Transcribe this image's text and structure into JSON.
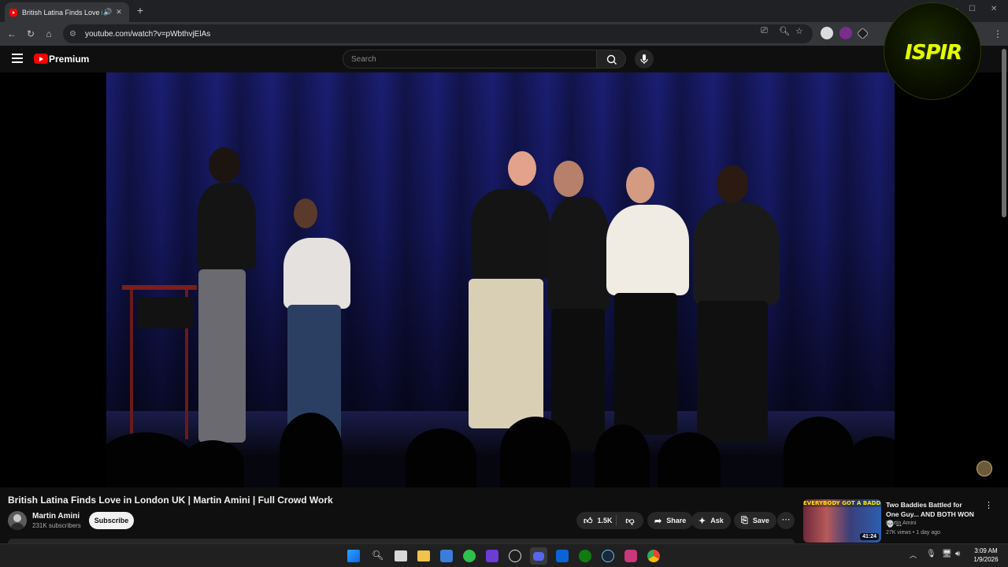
{
  "browser": {
    "tab_title": "British Latina Finds Love in London UK | Martin Amini | Full Crowd Work",
    "new_tab_label": "+",
    "url": "youtube.com/watch?v=pWbthvjElAs"
  },
  "youtube": {
    "logo_text": "Premium",
    "search_placeholder": "Search"
  },
  "overlay": {
    "logo_text": "ISPIR"
  },
  "video": {
    "title": "British Latina Finds Love in London UK | Martin Amini | Full Crowd Work",
    "channel_name": "Martin Amini",
    "subscribers": "231K subscribers",
    "subscribe_label": "Subscribe",
    "likes": "1.5K",
    "share_label": "Share",
    "ask_label": "Ask",
    "save_label": "Save"
  },
  "recommendation": {
    "thumb_text": "EVERYBODY GOT A BADDIE",
    "duration": "41:24",
    "title": "Two Baddies Battled for One Guy... AND BOTH WON 💀 ...",
    "channel": "Martin Amini",
    "meta": "27K views • 1 day ago"
  },
  "taskbar": {
    "time": "3:09 AM",
    "date": "1/9/2026"
  },
  "colors": {
    "brand_red": "#ff0000",
    "background": "#0f0f0f"
  }
}
